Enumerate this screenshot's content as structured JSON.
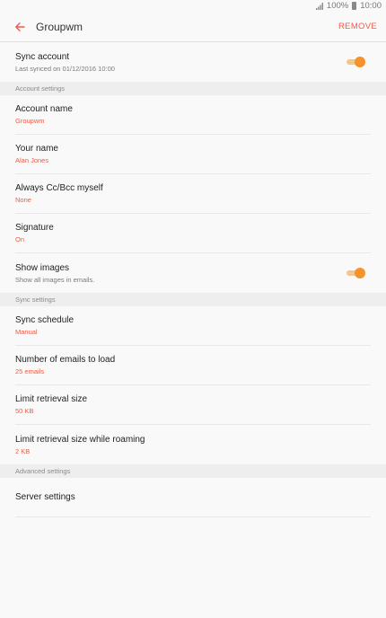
{
  "status": {
    "battery": "100%",
    "time": "10:00"
  },
  "header": {
    "title": "Groupwm",
    "remove_label": "REMOVE"
  },
  "sync_account": {
    "title": "Sync account",
    "subtitle": "Last synced on 01/12/2016  10:00",
    "enabled": true
  },
  "sections": {
    "account": "Account settings",
    "sync": "Sync settings",
    "advanced": "Advanced settings"
  },
  "account_settings": {
    "account_name": {
      "title": "Account name",
      "value": "Groupwm"
    },
    "your_name": {
      "title": "Your name",
      "value": "Alan Jones"
    },
    "cc_bcc": {
      "title": "Always Cc/Bcc myself",
      "value": "None"
    },
    "signature": {
      "title": "Signature",
      "value": "On"
    },
    "show_images": {
      "title": "Show images",
      "subtitle": "Show all images in emails.",
      "enabled": true
    }
  },
  "sync_settings": {
    "schedule": {
      "title": "Sync schedule",
      "value": "Manual"
    },
    "emails_to_load": {
      "title": "Number of emails to load",
      "value": "25 emails"
    },
    "retrieval_size": {
      "title": "Limit retrieval size",
      "value": "50 KB"
    },
    "retrieval_roaming": {
      "title": "Limit retrieval size while roaming",
      "value": "2 KB"
    }
  },
  "advanced_settings": {
    "server": {
      "title": "Server settings"
    }
  },
  "colors": {
    "accent": "#f15a4a",
    "toggle_on": "#f6922b"
  }
}
